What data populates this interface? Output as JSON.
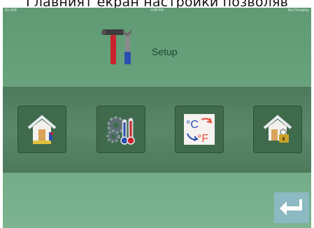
{
  "clipped_caption": "Главният екран настройки позволяв",
  "status_bar": {
    "left": "No SIM",
    "time": "4:08 PM",
    "right": "Not Charging"
  },
  "header": {
    "title": "Setup",
    "icon": "tools-icon"
  },
  "tiles": [
    {
      "name": "home-info-tile",
      "icon": "house-info-icon"
    },
    {
      "name": "system-settings-tile",
      "icon": "gears-thermometer-icon"
    },
    {
      "name": "temperature-units-tile",
      "icon": "celsius-fahrenheit-icon",
      "c_label": "°C",
      "f_label": "°F"
    },
    {
      "name": "security-lock-tile",
      "icon": "house-lock-icon"
    }
  ],
  "footer": {
    "back_icon": "back-arrow-icon"
  },
  "colors": {
    "background": "#6aa47f",
    "band": "#4e7a5c",
    "tile": "#3f6b4c",
    "back_button": "#8cb9c2",
    "title": "#1d4a2b"
  }
}
